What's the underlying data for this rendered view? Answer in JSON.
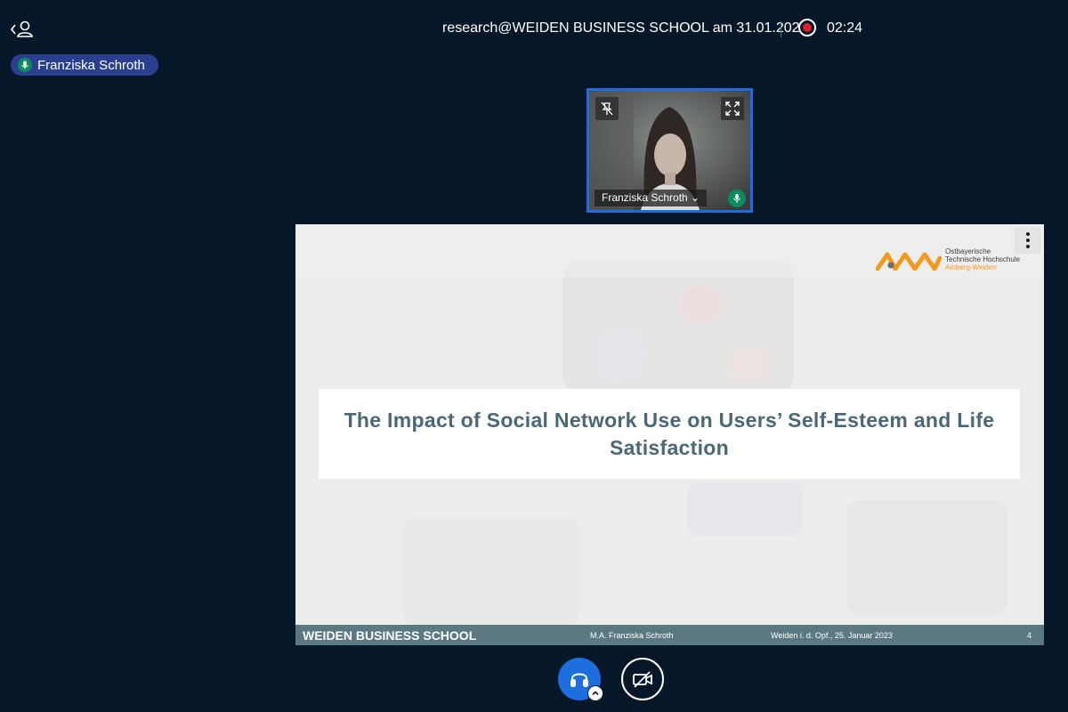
{
  "header": {
    "meeting_title": "research@WEIDEN BUSINESS SCHOOL am 31.01.2023",
    "recording_time": "02:24"
  },
  "talking_indicator": {
    "name": "Franziska Schroth"
  },
  "webcam": {
    "participant_name": "Franziska Schroth ⌄"
  },
  "presentation": {
    "logo": {
      "line1": "Ostbayerische",
      "line2": "Technische Hochschule",
      "line3": "Amberg-Weiden"
    },
    "slide_title": "The Impact of Social Network Use on Users’ Self-Esteem and Life Satisfaction",
    "footer": {
      "school": "WEIDEN BUSINESS SCHOOL",
      "author": "M.A. Franziska Schroth",
      "date": "Weiden i. d. Opf., 25. Januar 2023",
      "page": "4"
    }
  },
  "colors": {
    "background": "#06172a",
    "accent_blue": "#1d6fe0",
    "talker_pill": "#2b3f8f",
    "record_red": "#e01e2d",
    "slide_footer": "#5c7983",
    "slide_title": "#4a6876",
    "logo_orange": "#f39a1e"
  },
  "icons": {
    "user_list_toggle": "user-chevron-icon",
    "recording": "record-dot-icon",
    "microphone": "microphone-icon",
    "pin": "pin-off-icon",
    "fullscreen": "fullscreen-icon",
    "options": "kebab-menu-icon",
    "audio": "headphones-icon",
    "audio_options": "chevron-up-icon",
    "video": "video-off-icon"
  }
}
